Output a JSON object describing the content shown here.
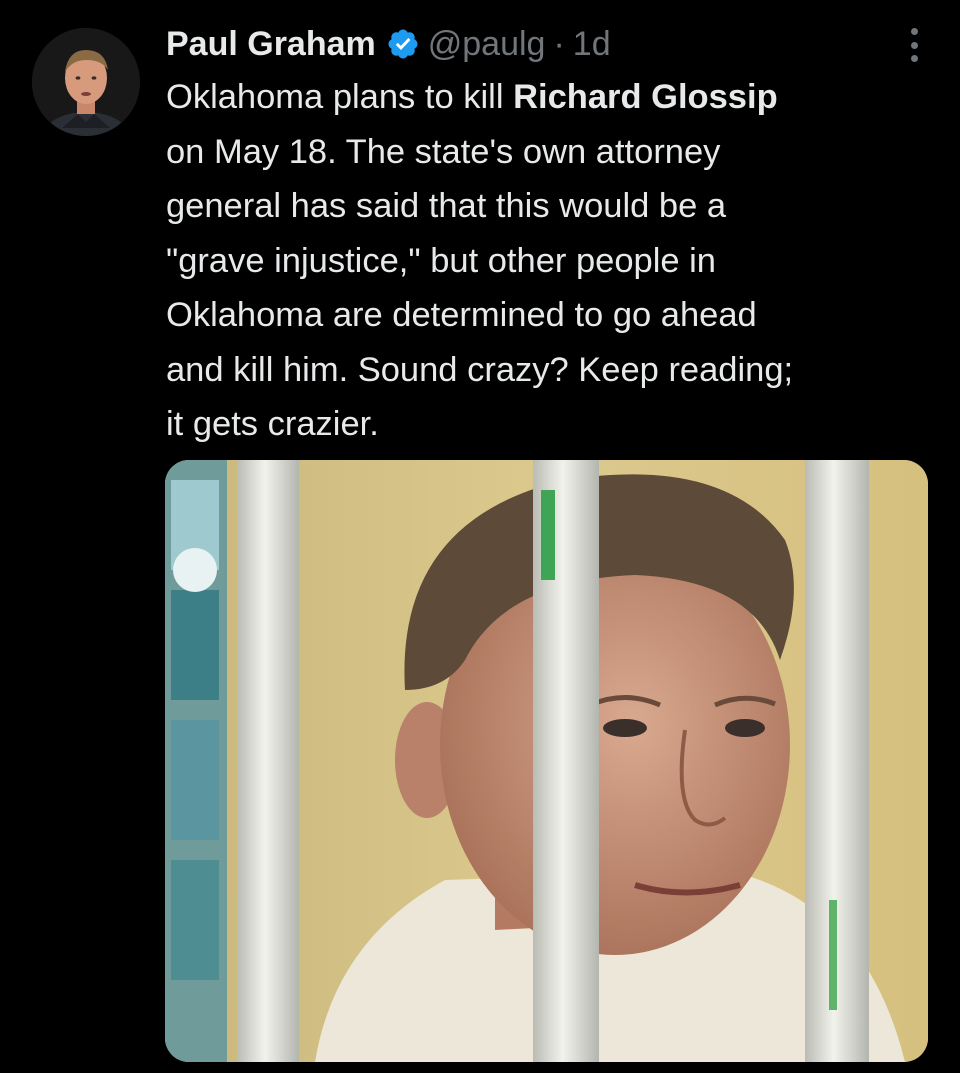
{
  "tweet": {
    "author": {
      "display_name": "Paul Graham",
      "handle": "@paulg",
      "verified": true,
      "avatar": "avatar-photo"
    },
    "separator": "·",
    "timestamp": "1d",
    "text_parts": [
      "Oklahoma plans to kill ",
      "Richard Glossip",
      "\non May 18. The state's own attorney\ngeneral has said that this would be a\n\"grave injustice,\" but other people in\nOklahoma are determined to go ahead\nand kill him. Sound crazy? Keep reading;\nit gets crazier."
    ],
    "media": {
      "type": "photo",
      "icon": "photo-image"
    },
    "more_icon": "more-horizontal-icon"
  },
  "colors": {
    "background": "#000000",
    "primary_text": "#e7e9ea",
    "secondary_text": "#71767b",
    "verified_blue": "#1d9bf0"
  }
}
